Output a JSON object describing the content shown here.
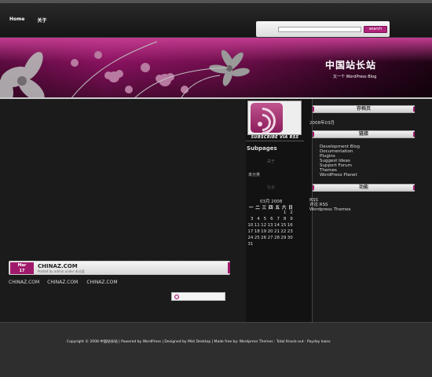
{
  "nav": {
    "home": "Home",
    "about": "关于"
  },
  "search": {
    "value": "",
    "button_label": "search"
  },
  "header": {
    "title": "中国站长站",
    "description": "又一个 WordPress Blog"
  },
  "post": {
    "date_month": "Mar",
    "date_day": "17",
    "title": "CHINAZ.COM",
    "meta": "Posted by admin under 未分类",
    "body": [
      "CHINAZ.COM",
      "CHINAZ.COM",
      "CHINAZ.COM"
    ]
  },
  "rss": {
    "label": "SUBSCRIBE VIA RSS"
  },
  "subpages": {
    "title": "Subpages",
    "items": [
      "关于",
      "未分类",
      "社会"
    ]
  },
  "calendar": {
    "caption": "03月  2008",
    "headers": [
      "一",
      "二",
      "三",
      "四",
      "五",
      "六",
      "日"
    ],
    "rows": [
      [
        "",
        "",
        "",
        "",
        "",
        "1",
        "2"
      ],
      [
        "3",
        "4",
        "5",
        "6",
        "7",
        "8",
        "9"
      ],
      [
        "10",
        "11",
        "12",
        "13",
        "14",
        "15",
        "16"
      ],
      [
        "17",
        "18",
        "19",
        "20",
        "21",
        "22",
        "23"
      ],
      [
        "24",
        "25",
        "26",
        "27",
        "28",
        "29",
        "30"
      ],
      [
        "31",
        "",
        "",
        "",
        "",
        "",
        ""
      ]
    ]
  },
  "sidebar": {
    "archives_title": "存档页",
    "archives": [
      "2008年03月"
    ],
    "links_title": "链接",
    "links": [
      "Development Blog",
      "Documentation",
      "Plugins",
      "Suggest Ideas",
      "Support Forum",
      "Themes",
      "WordPress Planet"
    ],
    "func_title": "功能",
    "func": [
      "RSS",
      "评论  RSS",
      "Wordpress Themes"
    ]
  },
  "footer": {
    "text": "Copyright © 2008 中国站长站  |  Powered by WordPress | Designed by Mist Desktop | Made free by: Wordpress Themes : Total Knock-out : Payday loans"
  }
}
